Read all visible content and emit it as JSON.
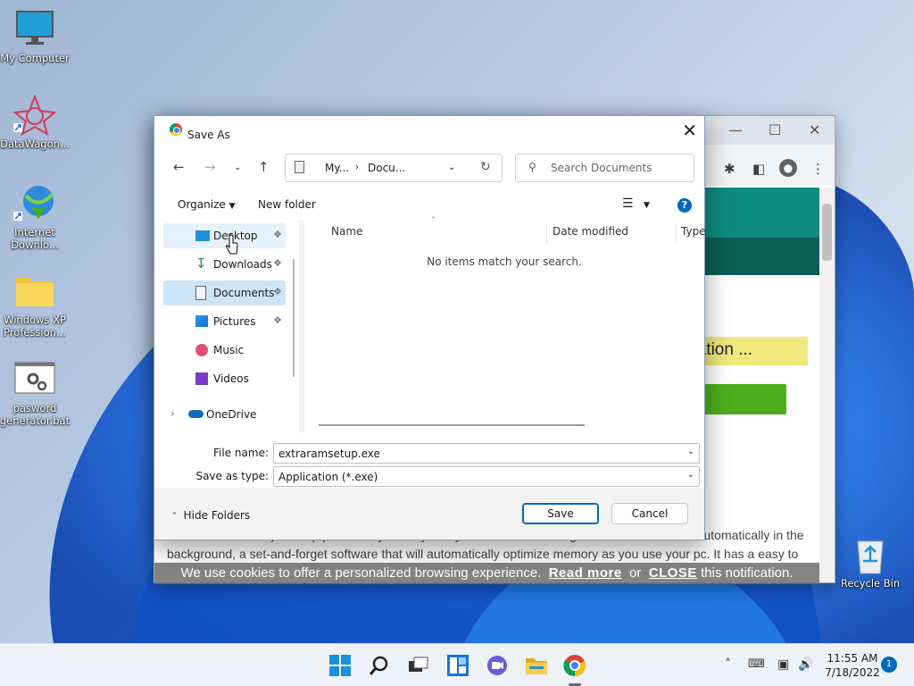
{
  "desktop": {
    "icons": [
      {
        "label": "My Computer"
      },
      {
        "label": "DataWagon..."
      },
      {
        "label": "Internet Downlo..."
      },
      {
        "label": "Windows XP Profession..."
      },
      {
        "label": "pasword generator.bat"
      },
      {
        "label": "Recycle Bin"
      }
    ]
  },
  "browser": {
    "banner_text": "ication ...",
    "paragraph": "Extra RAM instantly free up pc memory when your system need it. It designed to run and works automatically in the background, a set-and-forget software that will automatically optimize memory as you use your pc. It has a easy to use interface and provides all the information you need to know about your memory usage. It support all windows...",
    "cookie": {
      "prefix": "We use cookies to offer a personalized browsing experience.",
      "read_more": "Read more",
      "or": "or",
      "close": "CLOSE",
      "suffix": "this notification."
    }
  },
  "dialog": {
    "title": "Save As",
    "address": {
      "crumb1": "My...",
      "crumb2": "Docu..."
    },
    "search_placeholder": "Search Documents",
    "organize_label": "Organize",
    "new_folder_label": "New folder",
    "help_label": "?",
    "nav_items": [
      {
        "label": "Desktop",
        "pinned": true
      },
      {
        "label": "Downloads",
        "pinned": true
      },
      {
        "label": "Documents",
        "pinned": true,
        "selected": true
      },
      {
        "label": "Pictures",
        "pinned": true
      },
      {
        "label": "Music"
      },
      {
        "label": "Videos"
      },
      {
        "label": "OneDrive"
      }
    ],
    "columns": [
      "Name",
      "Date modified",
      "Type"
    ],
    "empty_message": "No items match your search.",
    "file_name_label": "File name:",
    "file_name_value": "extraramsetup.exe",
    "save_type_label": "Save as type:",
    "save_type_value": "Application (*.exe)",
    "hide_folders_label": "Hide Folders",
    "save_label": "Save",
    "cancel_label": "Cancel"
  },
  "taskbar": {
    "time": "11:55 AM",
    "date": "7/18/2022",
    "notification_count": "1"
  },
  "colors": {
    "accent": "#0067c0",
    "teal": "#0e8b7e",
    "selection": "#cce4f7"
  }
}
